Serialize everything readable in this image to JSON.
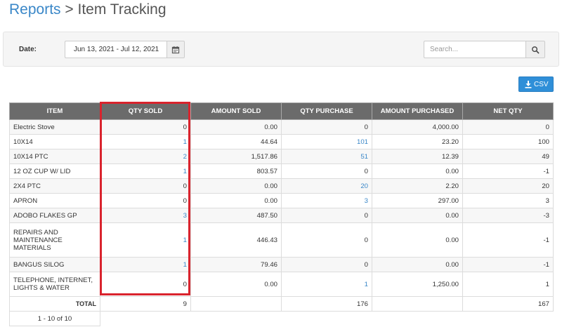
{
  "breadcrumb": {
    "parent": "Reports",
    "separator": ">",
    "current": "Item Tracking"
  },
  "filters": {
    "date_label": "Date:",
    "date_range": "Jun 13, 2021 - Jul 12, 2021",
    "search_placeholder": "Search..."
  },
  "icons": {
    "calendar": "calendar-icon",
    "search": "search-icon",
    "csv": "download-icon"
  },
  "export": {
    "csv_label": "CSV"
  },
  "colors": {
    "accent": "#2f8fd8",
    "link": "#3a87c8",
    "header_bg": "#6b6b6b",
    "highlight": "#d9232d"
  },
  "table": {
    "headers": {
      "item": "ITEM",
      "qty_sold": "QTY SOLD",
      "amount_sold": "AMOUNT SOLD",
      "qty_purchase": "QTY PURCHASE",
      "amount_purchased": "AMOUNT PURCHASED",
      "net_qty": "NET QTY"
    },
    "rows": [
      {
        "item": "Electric Stove",
        "qty_sold": "0",
        "amount_sold": "0.00",
        "qty_purchase": "0",
        "amount_purchased": "4,000.00",
        "net_qty": "0"
      },
      {
        "item": "10X14",
        "qty_sold": "1",
        "amount_sold": "44.64",
        "qty_purchase": "101",
        "amount_purchased": "23.20",
        "net_qty": "100"
      },
      {
        "item": "10X14 PTC",
        "qty_sold": "2",
        "amount_sold": "1,517.86",
        "qty_purchase": "51",
        "amount_purchased": "12.39",
        "net_qty": "49"
      },
      {
        "item": "12 OZ CUP W/ LID",
        "qty_sold": "1",
        "amount_sold": "803.57",
        "qty_purchase": "0",
        "amount_purchased": "0.00",
        "net_qty": "-1"
      },
      {
        "item": "2X4 PTC",
        "qty_sold": "0",
        "amount_sold": "0.00",
        "qty_purchase": "20",
        "amount_purchased": "2.20",
        "net_qty": "20"
      },
      {
        "item": "APRON",
        "qty_sold": "0",
        "amount_sold": "0.00",
        "qty_purchase": "3",
        "amount_purchased": "297.00",
        "net_qty": "3"
      },
      {
        "item": "ADOBO FLAKES GP",
        "qty_sold": "3",
        "amount_sold": "487.50",
        "qty_purchase": "0",
        "amount_purchased": "0.00",
        "net_qty": "-3"
      },
      {
        "item": "REPAIRS AND MAINTENANCE MATERIALS",
        "qty_sold": "1",
        "amount_sold": "446.43",
        "qty_purchase": "0",
        "amount_purchased": "0.00",
        "net_qty": "-1"
      },
      {
        "item": "BANGUS SILOG",
        "qty_sold": "1",
        "amount_sold": "79.46",
        "qty_purchase": "0",
        "amount_purchased": "0.00",
        "net_qty": "-1"
      },
      {
        "item": "TELEPHONE, INTERNET, LIGHTS & WATER",
        "qty_sold": "0",
        "amount_sold": "0.00",
        "qty_purchase": "1",
        "amount_purchased": "1,250.00",
        "net_qty": "1"
      }
    ],
    "totals": {
      "label": "TOTAL",
      "qty_sold": "9",
      "qty_purchase": "176",
      "net_qty": "167"
    },
    "pagination": "1 - 10 of 10"
  }
}
